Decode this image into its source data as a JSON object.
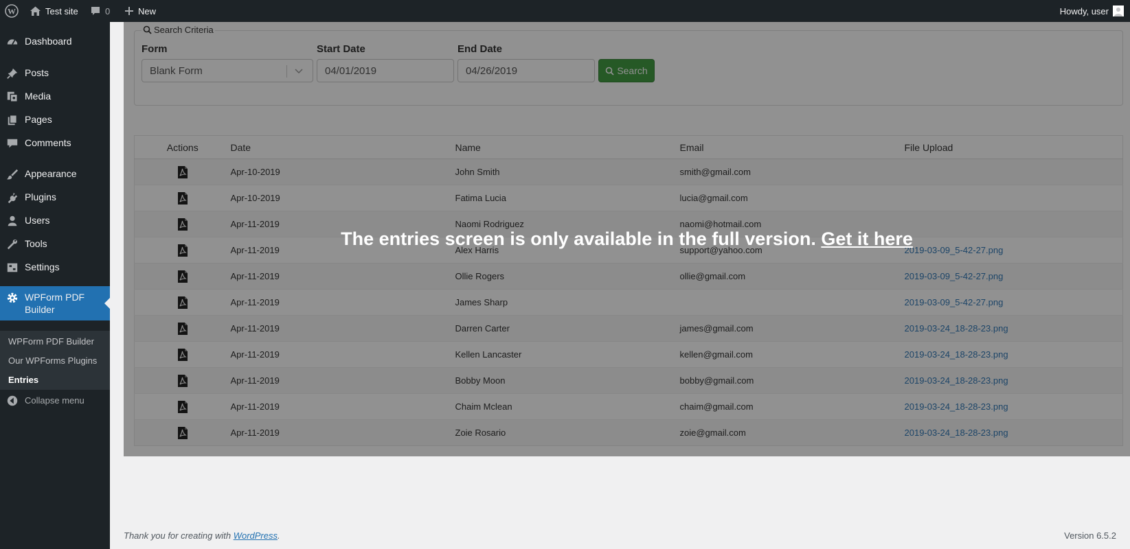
{
  "admin_bar": {
    "site_name": "Test site",
    "comments_count": "0",
    "new_label": "New",
    "howdy": "Howdy, user"
  },
  "sidebar": {
    "items": [
      {
        "label": "Dashboard",
        "icon": "dashboard-icon"
      },
      {
        "label": "Posts",
        "icon": "pin-icon"
      },
      {
        "label": "Media",
        "icon": "media-icon"
      },
      {
        "label": "Pages",
        "icon": "pages-icon"
      },
      {
        "label": "Comments",
        "icon": "comment-icon"
      },
      {
        "label": "Appearance",
        "icon": "brush-icon"
      },
      {
        "label": "Plugins",
        "icon": "plug-icon"
      },
      {
        "label": "Users",
        "icon": "user-icon"
      },
      {
        "label": "Tools",
        "icon": "wrench-icon"
      },
      {
        "label": "Settings",
        "icon": "settings-icon"
      }
    ],
    "current": {
      "label": "WPForm PDF Builder",
      "icon": "gear-icon"
    },
    "submenu": [
      "WPForm PDF Builder",
      "Our WPForms Plugins",
      "Entries"
    ],
    "collapse_label": "Collapse menu"
  },
  "search": {
    "legend": "Search Criteria",
    "form_label": "Form",
    "form_value": "Blank Form",
    "start_label": "Start Date",
    "start_value": "04/01/2019",
    "end_label": "End Date",
    "end_value": "04/26/2019",
    "button_label": "Search"
  },
  "table": {
    "headers": [
      "Actions",
      "Date",
      "Name",
      "Email",
      "File Upload"
    ],
    "rows": [
      {
        "date": "Apr-10-2019",
        "name": "John Smith",
        "email": "smith@gmail.com",
        "file": ""
      },
      {
        "date": "Apr-10-2019",
        "name": "Fatima Lucia",
        "email": "lucia@gmail.com",
        "file": ""
      },
      {
        "date": "Apr-11-2019",
        "name": "Naomi Rodriguez",
        "email": "naomi@hotmail.com",
        "file": ""
      },
      {
        "date": "Apr-11-2019",
        "name": "Alex Harris",
        "email": "support@yahoo.com",
        "file": "2019-03-09_5-42-27.png"
      },
      {
        "date": "Apr-11-2019",
        "name": "Ollie Rogers",
        "email": "ollie@gmail.com",
        "file": "2019-03-09_5-42-27.png"
      },
      {
        "date": "Apr-11-2019",
        "name": "James Sharp",
        "email": "",
        "file": "2019-03-09_5-42-27.png"
      },
      {
        "date": "Apr-11-2019",
        "name": "Darren Carter",
        "email": "james@gmail.com",
        "file": "2019-03-24_18-28-23.png"
      },
      {
        "date": "Apr-11-2019",
        "name": "Kellen Lancaster",
        "email": "kellen@gmail.com",
        "file": "2019-03-24_18-28-23.png"
      },
      {
        "date": "Apr-11-2019",
        "name": "Bobby Moon",
        "email": "bobby@gmail.com",
        "file": "2019-03-24_18-28-23.png"
      },
      {
        "date": "Apr-11-2019",
        "name": "Chaim Mclean",
        "email": "chaim@gmail.com",
        "file": "2019-03-24_18-28-23.png"
      },
      {
        "date": "Apr-11-2019",
        "name": "Zoie Rosario",
        "email": "zoie@gmail.com",
        "file": "2019-03-24_18-28-23.png"
      }
    ]
  },
  "overlay": {
    "message": "The entries screen is only available in the full version.",
    "link_label": "Get it here"
  },
  "footer": {
    "thanks_prefix": "Thank you for creating with",
    "wordpress_link": "WordPress",
    "thanks_suffix": ".",
    "version": "Version 6.5.2"
  }
}
